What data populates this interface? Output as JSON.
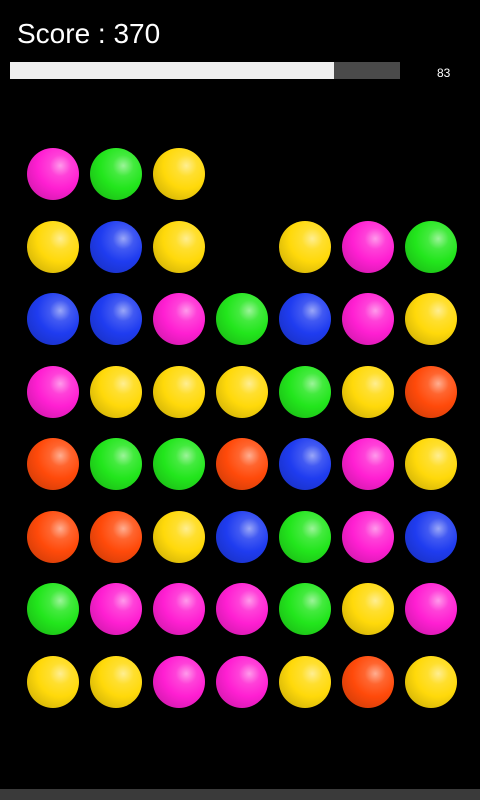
{
  "header": {
    "score_text": "Score : 370",
    "timer_text": "83"
  },
  "progress": {
    "fraction": 0.83,
    "fill_color": "#efefef",
    "track_color": "#4a4a4a"
  },
  "palette": {
    "magenta": "#ff1fd2",
    "green": "#22e61c",
    "yellow": "#ffd90a",
    "blue": "#1f3cf0",
    "orange": "#ff4a0a"
  },
  "board": {
    "columns": 7,
    "rows": [
      [
        "magenta",
        "green",
        "yellow",
        null,
        null,
        null,
        null
      ],
      [
        "yellow",
        "blue",
        "yellow",
        null,
        "yellow",
        "magenta",
        "green"
      ],
      [
        "blue",
        "blue",
        "magenta",
        "green",
        "blue",
        "magenta",
        "yellow"
      ],
      [
        "magenta",
        "yellow",
        "yellow",
        "yellow",
        "green",
        "yellow",
        "orange"
      ],
      [
        "orange",
        "green",
        "green",
        "orange",
        "blue",
        "magenta",
        "yellow"
      ],
      [
        "orange",
        "orange",
        "yellow",
        "blue",
        "green",
        "magenta",
        "blue"
      ],
      [
        "green",
        "magenta",
        "magenta",
        "magenta",
        "green",
        "yellow",
        "magenta"
      ],
      [
        "yellow",
        "yellow",
        "magenta",
        "magenta",
        "yellow",
        "orange",
        "yellow"
      ]
    ]
  }
}
